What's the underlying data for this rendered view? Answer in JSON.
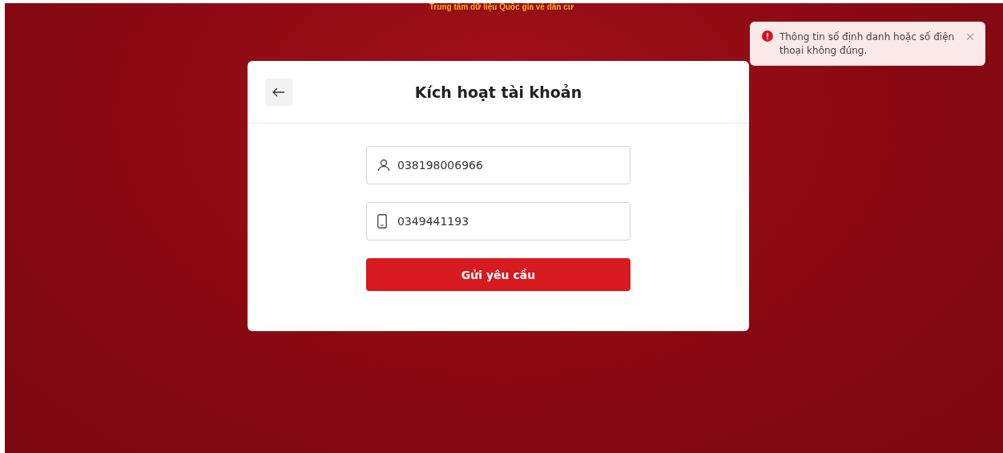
{
  "header": {
    "title": "Trung tâm dữ liệu Quốc gia về dân cư"
  },
  "card": {
    "title": "Kích hoạt tài khoản",
    "fields": [
      {
        "kind": "user",
        "value": "038198006966"
      },
      {
        "kind": "phone",
        "value": "0349441193"
      }
    ],
    "submit": "Gửi yêu cầu"
  },
  "toast": {
    "kind": "error",
    "message": "Thông tin số định danh hoặc số điện thoại không đúng."
  }
}
